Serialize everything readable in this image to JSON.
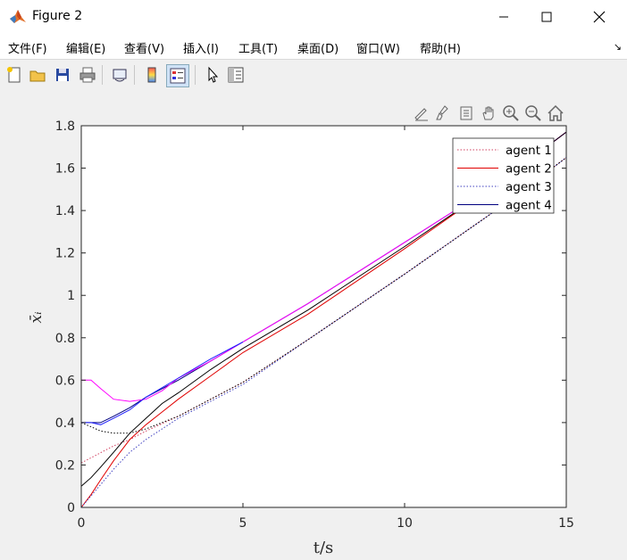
{
  "window": {
    "title": "Figure 2",
    "icon": "matlab-icon"
  },
  "window_controls": [
    "minimize-icon",
    "maximize-icon",
    "close-icon"
  ],
  "menu": {
    "items": [
      "文件(F)",
      "编辑(E)",
      "查看(V)",
      "插入(I)",
      "工具(T)",
      "桌面(D)",
      "窗口(W)",
      "帮助(H)"
    ]
  },
  "toolbar": {
    "icons": [
      "new-figure-icon",
      "open-file-icon",
      "save-icon",
      "print-icon",
      "link-plot-icon",
      "colorbar-icon",
      "legend-icon",
      "pointer-icon",
      "property-inspector-icon"
    ]
  },
  "axes_toolbar": {
    "icons": [
      "edit-plot-icon",
      "brush-icon",
      "data-tips-icon",
      "pan-icon",
      "zoom-in-icon",
      "zoom-out-icon",
      "home-icon"
    ]
  },
  "colors": {
    "agent1": "#d04060",
    "agent2": "#e00000",
    "agent3": "#4040c0",
    "agent4": "#000080",
    "magenta": "#ff00ff",
    "black": "#000000",
    "blue": "#2020ff"
  },
  "chart_data": {
    "type": "line",
    "xlabel": "t/s",
    "ylabel": "x̄ᵢ",
    "xlim": [
      0,
      15
    ],
    "ylim": [
      0,
      1.8
    ],
    "xticks": [
      "0",
      "5",
      "10",
      "15"
    ],
    "yticks": [
      "0",
      "0.2",
      "0.4",
      "0.6",
      "0.8",
      "1",
      "1.2",
      "1.4",
      "1.6",
      "1.8"
    ],
    "grid": false,
    "legend_position": "top-right",
    "legend": [
      "agent 1",
      "agent 2",
      "agent 3",
      "agent 4"
    ],
    "series": [
      {
        "name": "agent 1",
        "style": "dotted",
        "color": "#d04060",
        "x": [
          0,
          0.5,
          1,
          1.5,
          2,
          3,
          4,
          5,
          7,
          10,
          13,
          15
        ],
        "y": [
          0.21,
          0.25,
          0.29,
          0.32,
          0.36,
          0.43,
          0.51,
          0.59,
          0.79,
          1.1,
          1.42,
          1.65
        ]
      },
      {
        "name": "agent 2",
        "style": "solid",
        "color": "#e00000",
        "x": [
          0,
          0.3,
          0.6,
          1,
          1.5,
          2,
          2.5,
          3,
          4,
          5,
          7,
          10,
          13,
          15
        ],
        "y": [
          0.0,
          0.06,
          0.13,
          0.22,
          0.32,
          0.39,
          0.45,
          0.51,
          0.62,
          0.73,
          0.91,
          1.22,
          1.54,
          1.77
        ]
      },
      {
        "name": "agent 3",
        "style": "dotted",
        "color": "#4040c0",
        "x": [
          0,
          0.5,
          1,
          1.5,
          2,
          3,
          4,
          5,
          7,
          10,
          13,
          15
        ],
        "y": [
          0.0,
          0.09,
          0.18,
          0.26,
          0.32,
          0.42,
          0.5,
          0.58,
          0.79,
          1.1,
          1.42,
          1.65
        ]
      },
      {
        "name": "agent 4",
        "style": "solid",
        "color": "#000080",
        "x": [
          0,
          0.3,
          0.6,
          1,
          1.5,
          2,
          3,
          4,
          5,
          7,
          10,
          13,
          15
        ],
        "y": [
          0.4,
          0.4,
          0.4,
          0.43,
          0.47,
          0.52,
          0.6,
          0.69,
          0.78,
          0.96,
          1.25,
          1.54,
          1.77
        ]
      },
      {
        "name": "",
        "style": "solid",
        "color": "#ff00ff",
        "x": [
          0,
          0.3,
          0.6,
          1,
          1.5,
          2,
          2.5,
          3,
          4,
          5,
          7,
          10,
          13,
          15
        ],
        "y": [
          0.6,
          0.6,
          0.56,
          0.51,
          0.5,
          0.51,
          0.55,
          0.61,
          0.69,
          0.78,
          0.96,
          1.25,
          1.54,
          1.77
        ]
      },
      {
        "name": "",
        "style": "solid",
        "color": "#000000",
        "x": [
          0,
          0.3,
          0.6,
          1,
          1.5,
          2,
          2.5,
          3,
          4,
          5,
          7,
          10,
          13,
          15
        ],
        "y": [
          0.1,
          0.14,
          0.19,
          0.26,
          0.35,
          0.42,
          0.49,
          0.54,
          0.65,
          0.75,
          0.93,
          1.23,
          1.54,
          1.77
        ]
      },
      {
        "name": "",
        "style": "dotted",
        "color": "#000000",
        "x": [
          0,
          0.3,
          0.6,
          1,
          1.5,
          2,
          3,
          4,
          5,
          7,
          10,
          13,
          15
        ],
        "y": [
          0.4,
          0.38,
          0.36,
          0.35,
          0.35,
          0.37,
          0.43,
          0.51,
          0.59,
          0.79,
          1.1,
          1.42,
          1.65
        ]
      },
      {
        "name": "",
        "style": "solid",
        "color": "#2020ff",
        "x": [
          0,
          0.3,
          0.6,
          1,
          1.5,
          2,
          3,
          4,
          5
        ],
        "y": [
          0.4,
          0.4,
          0.39,
          0.42,
          0.46,
          0.52,
          0.61,
          0.7,
          0.78
        ]
      }
    ]
  }
}
